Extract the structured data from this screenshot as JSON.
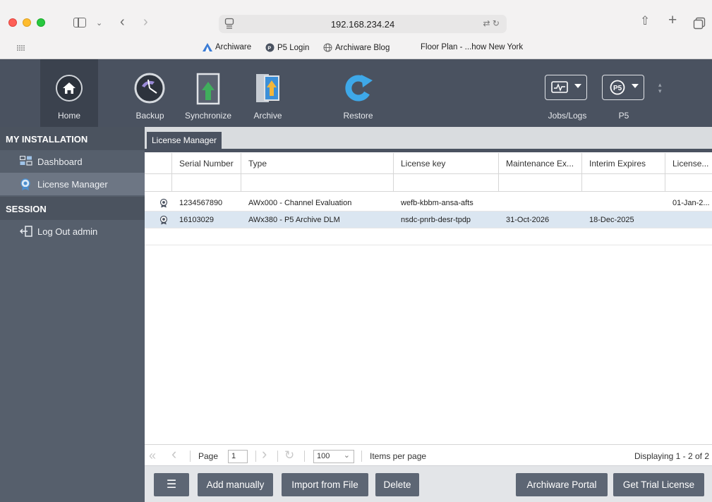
{
  "browser": {
    "address": "192.168.234.24",
    "bookmarks": [
      {
        "label": "Archiware",
        "icon": "archiware-logo-icon"
      },
      {
        "label": "P5 Login",
        "icon": "p5-logo-icon"
      },
      {
        "label": "Archiware Blog",
        "icon": "globe-icon"
      },
      {
        "label": "Floor Plan - ...how New York",
        "icon": ""
      }
    ]
  },
  "toolbar": {
    "items": [
      {
        "label": "Home",
        "icon": "home-icon"
      },
      {
        "label": "Backup",
        "icon": "backup-clock-icon"
      },
      {
        "label": "Synchronize",
        "icon": "synchronize-icon"
      },
      {
        "label": "Archive",
        "icon": "archive-icon"
      },
      {
        "label": "Restore",
        "icon": "restore-icon"
      }
    ],
    "right": [
      {
        "label": "Jobs/Logs",
        "icon": "monitor-icon"
      },
      {
        "label": "P5",
        "icon": "p5-icon"
      }
    ]
  },
  "sidebar": {
    "sections": [
      {
        "title": "MY INSTALLATION",
        "items": [
          {
            "label": "Dashboard",
            "icon": "dashboard-icon",
            "active": false
          },
          {
            "label": "License Manager",
            "icon": "license-icon",
            "active": true
          }
        ]
      },
      {
        "title": "SESSION",
        "items": [
          {
            "label": "Log Out admin",
            "icon": "logout-icon",
            "active": false
          }
        ]
      }
    ]
  },
  "main": {
    "tab": "License Manager",
    "columns": [
      "",
      "Serial Number",
      "Type",
      "License key",
      "Maintenance Ex...",
      "Interim Expires",
      "License..."
    ],
    "rows": [
      {
        "serial": "1234567890",
        "type": "AWx000 - Channel Evaluation",
        "key": "wefb-kbbm-ansa-afts",
        "maint": "",
        "interim": "",
        "license": "01-Jan-2...",
        "selected": false
      },
      {
        "serial": "16103029",
        "type": "AWx380 - P5 Archive DLM",
        "key": "nsdc-pnrb-desr-tpdp",
        "maint": "31-Oct-2026",
        "interim": "18-Dec-2025",
        "license": "",
        "selected": true
      }
    ],
    "pager": {
      "page_label": "Page",
      "page": "1",
      "per_page": "100",
      "per_page_label": "Items per page",
      "display": "Displaying 1 - 2 of 2"
    },
    "buttons": {
      "menu": "☰",
      "add": "Add manually",
      "import": "Import from File",
      "delete": "Delete",
      "portal": "Archiware Portal",
      "trial": "Get Trial License"
    }
  },
  "colors": {
    "toolbar_bg": "#4a5260",
    "sidebar_bg": "#565f6c",
    "selected_row": "#dbe6f1",
    "button_bg": "#5d6674"
  }
}
